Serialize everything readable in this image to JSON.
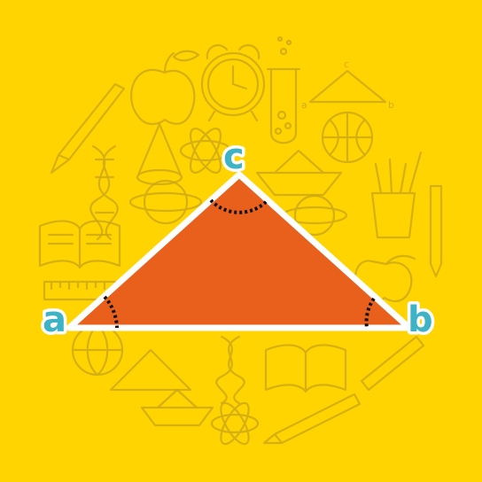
{
  "background_color": "#ffd400",
  "triangle": {
    "fill_color": "#e8601c",
    "outline_color": "#ffffff",
    "label_color": "#3fb3c6",
    "vertices": {
      "a": "a",
      "b": "b",
      "c": "c"
    }
  },
  "background_icons": [
    "apple-icon",
    "alarm-clock-icon",
    "test-tube-icon",
    "triangle-diagram-icon",
    "pen-icon",
    "dna-icon",
    "cone-icon",
    "atom-icon",
    "paper-boat-icon",
    "basketball-icon",
    "pencil-cup-icon",
    "book-icon",
    "planet-icon",
    "ruler-icon",
    "globe-icon",
    "pencil-icon",
    "fountain-pen-icon"
  ],
  "background_diagram_labels": {
    "a": "a",
    "b": "b",
    "c": "c"
  }
}
